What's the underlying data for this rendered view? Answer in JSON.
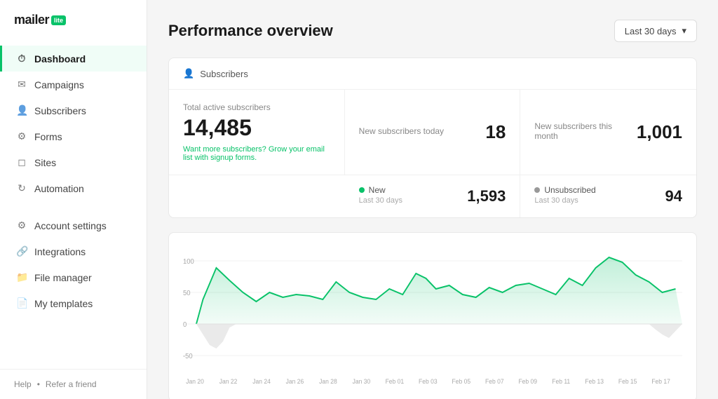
{
  "sidebar": {
    "logo": "mailer",
    "logo_badge": "lite",
    "nav_items": [
      {
        "id": "dashboard",
        "label": "Dashboard",
        "icon": "⏱",
        "active": true
      },
      {
        "id": "campaigns",
        "label": "Campaigns",
        "icon": "✉",
        "active": false
      },
      {
        "id": "subscribers",
        "label": "Subscribers",
        "icon": "👤",
        "active": false
      },
      {
        "id": "forms",
        "label": "Forms",
        "icon": "⚙",
        "active": false
      },
      {
        "id": "sites",
        "label": "Sites",
        "icon": "◻",
        "active": false
      },
      {
        "id": "automation",
        "label": "Automation",
        "icon": "↻",
        "active": false
      },
      {
        "id": "account-settings",
        "label": "Account settings",
        "icon": "⚙",
        "active": false
      },
      {
        "id": "integrations",
        "label": "Integrations",
        "icon": "🔗",
        "active": false
      },
      {
        "id": "file-manager",
        "label": "File manager",
        "icon": "📁",
        "active": false
      },
      {
        "id": "my-templates",
        "label": "My templates",
        "icon": "📄",
        "active": false
      }
    ],
    "bottom": {
      "help": "Help",
      "separator": "•",
      "refer": "Refer a friend"
    }
  },
  "header": {
    "title": "Performance overview",
    "date_range_label": "Last 30 days"
  },
  "subscribers_section": {
    "section_label": "Subscribers",
    "total_label": "Total active subscribers",
    "total_value": "14,485",
    "grow_text": "Want more subscribers? Grow your email list with",
    "grow_link": "signup forms.",
    "new_today_label": "New subscribers today",
    "new_today_value": "18",
    "new_month_label": "New subscribers this month",
    "new_month_value": "1,001",
    "new_label": "New",
    "new_period": "Last 30 days",
    "new_value": "1,593",
    "unsub_label": "Unsubscribed",
    "unsub_period": "Last 30 days",
    "unsub_value": "94"
  },
  "chart": {
    "x_labels": [
      "Jan 20",
      "Jan 22",
      "Jan 24",
      "Jan 26",
      "Jan 28",
      "Jan 30",
      "Feb 01",
      "Feb 03",
      "Feb 05",
      "Feb 07",
      "Feb 09",
      "Feb 11",
      "Feb 13",
      "Feb 15",
      "Feb 17"
    ],
    "y_labels": [
      "100",
      "50",
      "0",
      "-50"
    ],
    "accent_color": "#09c269",
    "fill_color": "rgba(9,194,105,0.15)",
    "negative_color": "rgba(180,180,180,0.3)"
  }
}
